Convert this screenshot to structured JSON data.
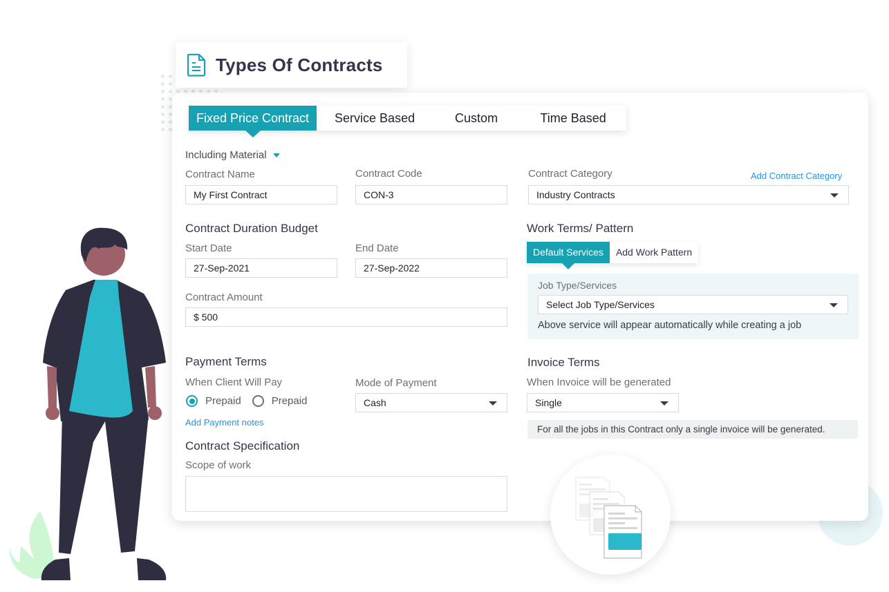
{
  "header": {
    "title": "Types Of Contracts",
    "icon": "document-icon"
  },
  "tabs": [
    {
      "label": "Fixed Price Contract",
      "active": true
    },
    {
      "label": "Service Based",
      "active": false
    },
    {
      "label": "Custom",
      "active": false
    },
    {
      "label": "Time Based",
      "active": false
    }
  ],
  "material_dropdown": {
    "label": "Including Material"
  },
  "contract_name": {
    "label": "Contract Name",
    "value": "My First Contract"
  },
  "contract_code": {
    "label": "Contract Code",
    "value": "CON-3"
  },
  "contract_category": {
    "label": "Contract Category",
    "value": "Industry Contracts",
    "add_link": "Add Contract Category"
  },
  "duration": {
    "heading": "Contract Duration Budget",
    "start_label": "Start Date",
    "start_value": "27-Sep-2021",
    "end_label": "End Date",
    "end_value": "27-Sep-2022"
  },
  "amount": {
    "label": "Contract Amount",
    "value": "$ 500"
  },
  "work_terms": {
    "heading": "Work Terms/ Pattern",
    "subtabs": [
      {
        "label": "Default Services",
        "active": true
      },
      {
        "label": "Add Work Pattern",
        "active": false
      }
    ],
    "job_type_label": "Job Type/Services",
    "job_type_value": "Select Job Type/Services",
    "job_hint": "Above service will appear automatically while creating a job"
  },
  "payment": {
    "heading": "Payment Terms",
    "when_label": "When Client Will Pay",
    "options": [
      {
        "label": "Prepaid",
        "checked": true
      },
      {
        "label": "Prepaid",
        "checked": false
      }
    ],
    "notes_link": "Add Payment notes",
    "mode_label": "Mode of Payment",
    "mode_value": "Cash"
  },
  "invoice": {
    "heading": "Invoice Terms",
    "when_label": "When Invoice will be generated",
    "value": "Single",
    "note": "For all the jobs in this Contract only a single invoice will be generated."
  },
  "specification": {
    "heading": "Contract Specification",
    "scope_label": "Scope of work",
    "scope_value": ""
  },
  "colors": {
    "accent": "#17a2b3",
    "link": "#2196e8",
    "heading": "#35344e",
    "panel_bg": "#eef6f8"
  }
}
